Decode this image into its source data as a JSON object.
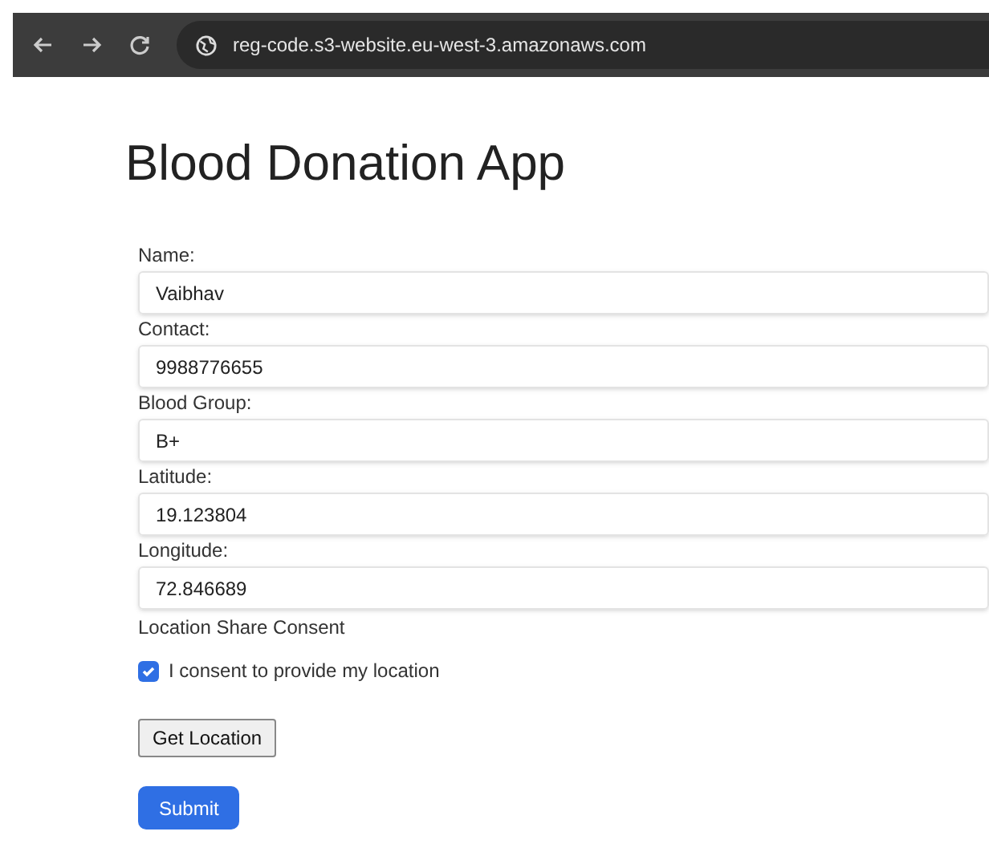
{
  "browser": {
    "url": "reg-code.s3-website.eu-west-3.amazonaws.com"
  },
  "title": "Blood Donation App",
  "fields": [
    {
      "label": "Name:",
      "value": "Vaibhav"
    },
    {
      "label": "Contact:",
      "value": "9988776655"
    },
    {
      "label": "Blood Group:",
      "value": "B+"
    },
    {
      "label": "Latitude:",
      "value": "19.123804"
    },
    {
      "label": "Longitude:",
      "value": "72.846689"
    }
  ],
  "consent": {
    "heading": "Location Share Consent",
    "label": "I consent to provide my location",
    "checked": true
  },
  "buttons": [
    {
      "label": "Get Location",
      "kind": "plain"
    },
    {
      "label": "Submit",
      "kind": "primary"
    }
  ]
}
